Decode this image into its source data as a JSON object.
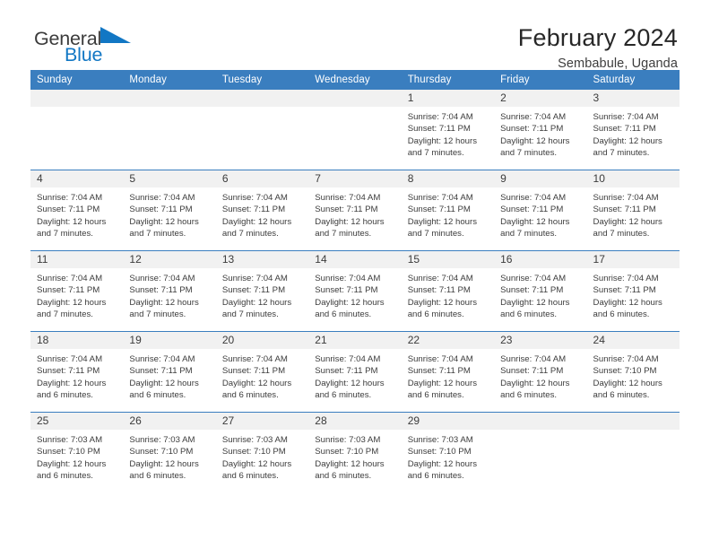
{
  "brand": {
    "name_part1": "General",
    "name_part2": "Blue",
    "triangle_icon": "blue-triangle-icon",
    "accent_color": "#1277c4"
  },
  "header": {
    "title": "February 2024",
    "subtitle": "Sembabule, Uganda"
  },
  "theme": {
    "header_bar_color": "#3a7ebf",
    "daynum_band_color": "#f1f1f1",
    "text_color": "#3c3c3c"
  },
  "weekday_headers": [
    "Sunday",
    "Monday",
    "Tuesday",
    "Wednesday",
    "Thursday",
    "Friday",
    "Saturday"
  ],
  "labels": {
    "sunrise_prefix": "Sunrise: ",
    "sunset_prefix": "Sunset: ",
    "daylight_prefix": "Daylight: "
  },
  "weeks": [
    {
      "days": [
        {
          "num": "",
          "empty": true
        },
        {
          "num": "",
          "empty": true
        },
        {
          "num": "",
          "empty": true
        },
        {
          "num": "",
          "empty": true
        },
        {
          "num": "1",
          "sunrise": "Sunrise: 7:04 AM",
          "sunset": "Sunset: 7:11 PM",
          "daylight_line1": "Daylight: 12 hours",
          "daylight_line2": "and 7 minutes."
        },
        {
          "num": "2",
          "sunrise": "Sunrise: 7:04 AM",
          "sunset": "Sunset: 7:11 PM",
          "daylight_line1": "Daylight: 12 hours",
          "daylight_line2": "and 7 minutes."
        },
        {
          "num": "3",
          "sunrise": "Sunrise: 7:04 AM",
          "sunset": "Sunset: 7:11 PM",
          "daylight_line1": "Daylight: 12 hours",
          "daylight_line2": "and 7 minutes."
        }
      ]
    },
    {
      "days": [
        {
          "num": "4",
          "sunrise": "Sunrise: 7:04 AM",
          "sunset": "Sunset: 7:11 PM",
          "daylight_line1": "Daylight: 12 hours",
          "daylight_line2": "and 7 minutes."
        },
        {
          "num": "5",
          "sunrise": "Sunrise: 7:04 AM",
          "sunset": "Sunset: 7:11 PM",
          "daylight_line1": "Daylight: 12 hours",
          "daylight_line2": "and 7 minutes."
        },
        {
          "num": "6",
          "sunrise": "Sunrise: 7:04 AM",
          "sunset": "Sunset: 7:11 PM",
          "daylight_line1": "Daylight: 12 hours",
          "daylight_line2": "and 7 minutes."
        },
        {
          "num": "7",
          "sunrise": "Sunrise: 7:04 AM",
          "sunset": "Sunset: 7:11 PM",
          "daylight_line1": "Daylight: 12 hours",
          "daylight_line2": "and 7 minutes."
        },
        {
          "num": "8",
          "sunrise": "Sunrise: 7:04 AM",
          "sunset": "Sunset: 7:11 PM",
          "daylight_line1": "Daylight: 12 hours",
          "daylight_line2": "and 7 minutes."
        },
        {
          "num": "9",
          "sunrise": "Sunrise: 7:04 AM",
          "sunset": "Sunset: 7:11 PM",
          "daylight_line1": "Daylight: 12 hours",
          "daylight_line2": "and 7 minutes."
        },
        {
          "num": "10",
          "sunrise": "Sunrise: 7:04 AM",
          "sunset": "Sunset: 7:11 PM",
          "daylight_line1": "Daylight: 12 hours",
          "daylight_line2": "and 7 minutes."
        }
      ]
    },
    {
      "days": [
        {
          "num": "11",
          "sunrise": "Sunrise: 7:04 AM",
          "sunset": "Sunset: 7:11 PM",
          "daylight_line1": "Daylight: 12 hours",
          "daylight_line2": "and 7 minutes."
        },
        {
          "num": "12",
          "sunrise": "Sunrise: 7:04 AM",
          "sunset": "Sunset: 7:11 PM",
          "daylight_line1": "Daylight: 12 hours",
          "daylight_line2": "and 7 minutes."
        },
        {
          "num": "13",
          "sunrise": "Sunrise: 7:04 AM",
          "sunset": "Sunset: 7:11 PM",
          "daylight_line1": "Daylight: 12 hours",
          "daylight_line2": "and 7 minutes."
        },
        {
          "num": "14",
          "sunrise": "Sunrise: 7:04 AM",
          "sunset": "Sunset: 7:11 PM",
          "daylight_line1": "Daylight: 12 hours",
          "daylight_line2": "and 6 minutes."
        },
        {
          "num": "15",
          "sunrise": "Sunrise: 7:04 AM",
          "sunset": "Sunset: 7:11 PM",
          "daylight_line1": "Daylight: 12 hours",
          "daylight_line2": "and 6 minutes."
        },
        {
          "num": "16",
          "sunrise": "Sunrise: 7:04 AM",
          "sunset": "Sunset: 7:11 PM",
          "daylight_line1": "Daylight: 12 hours",
          "daylight_line2": "and 6 minutes."
        },
        {
          "num": "17",
          "sunrise": "Sunrise: 7:04 AM",
          "sunset": "Sunset: 7:11 PM",
          "daylight_line1": "Daylight: 12 hours",
          "daylight_line2": "and 6 minutes."
        }
      ]
    },
    {
      "days": [
        {
          "num": "18",
          "sunrise": "Sunrise: 7:04 AM",
          "sunset": "Sunset: 7:11 PM",
          "daylight_line1": "Daylight: 12 hours",
          "daylight_line2": "and 6 minutes."
        },
        {
          "num": "19",
          "sunrise": "Sunrise: 7:04 AM",
          "sunset": "Sunset: 7:11 PM",
          "daylight_line1": "Daylight: 12 hours",
          "daylight_line2": "and 6 minutes."
        },
        {
          "num": "20",
          "sunrise": "Sunrise: 7:04 AM",
          "sunset": "Sunset: 7:11 PM",
          "daylight_line1": "Daylight: 12 hours",
          "daylight_line2": "and 6 minutes."
        },
        {
          "num": "21",
          "sunrise": "Sunrise: 7:04 AM",
          "sunset": "Sunset: 7:11 PM",
          "daylight_line1": "Daylight: 12 hours",
          "daylight_line2": "and 6 minutes."
        },
        {
          "num": "22",
          "sunrise": "Sunrise: 7:04 AM",
          "sunset": "Sunset: 7:11 PM",
          "daylight_line1": "Daylight: 12 hours",
          "daylight_line2": "and 6 minutes."
        },
        {
          "num": "23",
          "sunrise": "Sunrise: 7:04 AM",
          "sunset": "Sunset: 7:11 PM",
          "daylight_line1": "Daylight: 12 hours",
          "daylight_line2": "and 6 minutes."
        },
        {
          "num": "24",
          "sunrise": "Sunrise: 7:04 AM",
          "sunset": "Sunset: 7:10 PM",
          "daylight_line1": "Daylight: 12 hours",
          "daylight_line2": "and 6 minutes."
        }
      ]
    },
    {
      "days": [
        {
          "num": "25",
          "sunrise": "Sunrise: 7:03 AM",
          "sunset": "Sunset: 7:10 PM",
          "daylight_line1": "Daylight: 12 hours",
          "daylight_line2": "and 6 minutes."
        },
        {
          "num": "26",
          "sunrise": "Sunrise: 7:03 AM",
          "sunset": "Sunset: 7:10 PM",
          "daylight_line1": "Daylight: 12 hours",
          "daylight_line2": "and 6 minutes."
        },
        {
          "num": "27",
          "sunrise": "Sunrise: 7:03 AM",
          "sunset": "Sunset: 7:10 PM",
          "daylight_line1": "Daylight: 12 hours",
          "daylight_line2": "and 6 minutes."
        },
        {
          "num": "28",
          "sunrise": "Sunrise: 7:03 AM",
          "sunset": "Sunset: 7:10 PM",
          "daylight_line1": "Daylight: 12 hours",
          "daylight_line2": "and 6 minutes."
        },
        {
          "num": "29",
          "sunrise": "Sunrise: 7:03 AM",
          "sunset": "Sunset: 7:10 PM",
          "daylight_line1": "Daylight: 12 hours",
          "daylight_line2": "and 6 minutes."
        },
        {
          "num": "",
          "empty": true
        },
        {
          "num": "",
          "empty": true
        }
      ]
    }
  ]
}
